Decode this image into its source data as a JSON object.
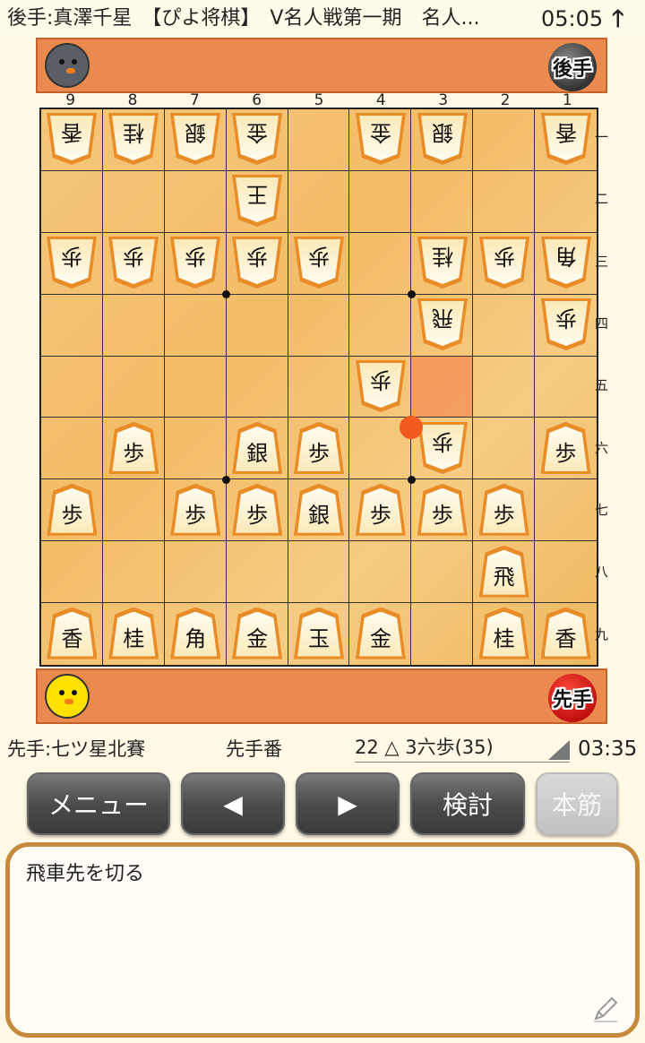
{
  "header": {
    "title": "後手:真澤千星　【ぴよ将棋】　V名人戦第一期　名人...",
    "time": "05:05",
    "up_arrow": "🡑"
  },
  "gote_hand": {
    "badge": "後手",
    "avatar_icon": "gray-chick-avatar"
  },
  "sente_hand": {
    "badge": "先手",
    "avatar_icon": "yellow-chick-avatar"
  },
  "board": {
    "file_labels": [
      "9",
      "8",
      "7",
      "6",
      "5",
      "4",
      "3",
      "2",
      "1"
    ],
    "rank_labels": [
      "一",
      "二",
      "三",
      "四",
      "五",
      "六",
      "七",
      "八",
      "九"
    ],
    "highlight_square": {
      "file": 3,
      "rank": 5
    },
    "last_move_marker": {
      "file": 3,
      "rank": 6
    },
    "pieces": [
      {
        "file": 9,
        "rank": 1,
        "char": "香",
        "owner": "gote"
      },
      {
        "file": 8,
        "rank": 1,
        "char": "桂",
        "owner": "gote"
      },
      {
        "file": 7,
        "rank": 1,
        "char": "銀",
        "owner": "gote"
      },
      {
        "file": 6,
        "rank": 1,
        "char": "金",
        "owner": "gote"
      },
      {
        "file": 4,
        "rank": 1,
        "char": "金",
        "owner": "gote"
      },
      {
        "file": 3,
        "rank": 1,
        "char": "銀",
        "owner": "gote"
      },
      {
        "file": 1,
        "rank": 1,
        "char": "香",
        "owner": "gote"
      },
      {
        "file": 6,
        "rank": 2,
        "char": "王",
        "owner": "gote"
      },
      {
        "file": 9,
        "rank": 3,
        "char": "歩",
        "owner": "gote"
      },
      {
        "file": 8,
        "rank": 3,
        "char": "歩",
        "owner": "gote"
      },
      {
        "file": 7,
        "rank": 3,
        "char": "歩",
        "owner": "gote"
      },
      {
        "file": 6,
        "rank": 3,
        "char": "歩",
        "owner": "gote"
      },
      {
        "file": 5,
        "rank": 3,
        "char": "歩",
        "owner": "gote"
      },
      {
        "file": 3,
        "rank": 3,
        "char": "桂",
        "owner": "gote"
      },
      {
        "file": 2,
        "rank": 3,
        "char": "歩",
        "owner": "gote"
      },
      {
        "file": 1,
        "rank": 3,
        "char": "角",
        "owner": "gote"
      },
      {
        "file": 3,
        "rank": 4,
        "char": "飛",
        "owner": "gote"
      },
      {
        "file": 1,
        "rank": 4,
        "char": "歩",
        "owner": "gote"
      },
      {
        "file": 4,
        "rank": 5,
        "char": "歩",
        "owner": "gote"
      },
      {
        "file": 3,
        "rank": 6,
        "char": "歩",
        "owner": "gote"
      },
      {
        "file": 8,
        "rank": 6,
        "char": "歩",
        "owner": "sente"
      },
      {
        "file": 6,
        "rank": 6,
        "char": "銀",
        "owner": "sente"
      },
      {
        "file": 5,
        "rank": 6,
        "char": "歩",
        "owner": "sente"
      },
      {
        "file": 1,
        "rank": 6,
        "char": "歩",
        "owner": "sente"
      },
      {
        "file": 9,
        "rank": 7,
        "char": "歩",
        "owner": "sente"
      },
      {
        "file": 7,
        "rank": 7,
        "char": "歩",
        "owner": "sente"
      },
      {
        "file": 6,
        "rank": 7,
        "char": "歩",
        "owner": "sente"
      },
      {
        "file": 5,
        "rank": 7,
        "char": "銀",
        "owner": "sente"
      },
      {
        "file": 4,
        "rank": 7,
        "char": "歩",
        "owner": "sente"
      },
      {
        "file": 3,
        "rank": 7,
        "char": "歩",
        "owner": "sente"
      },
      {
        "file": 2,
        "rank": 7,
        "char": "歩",
        "owner": "sente"
      },
      {
        "file": 2,
        "rank": 8,
        "char": "飛",
        "owner": "sente"
      },
      {
        "file": 9,
        "rank": 9,
        "char": "香",
        "owner": "sente"
      },
      {
        "file": 8,
        "rank": 9,
        "char": "桂",
        "owner": "sente"
      },
      {
        "file": 7,
        "rank": 9,
        "char": "角",
        "owner": "sente"
      },
      {
        "file": 6,
        "rank": 9,
        "char": "金",
        "owner": "sente"
      },
      {
        "file": 5,
        "rank": 9,
        "char": "玉",
        "owner": "sente"
      },
      {
        "file": 4,
        "rank": 9,
        "char": "金",
        "owner": "sente"
      },
      {
        "file": 2,
        "rank": 9,
        "char": "桂",
        "owner": "sente"
      },
      {
        "file": 1,
        "rank": 9,
        "char": "香",
        "owner": "sente"
      }
    ]
  },
  "status": {
    "sente_name": "先手:七ツ星北賽",
    "turn": "先手番",
    "move": "22 △ 3六歩(35)",
    "clock": "03:35"
  },
  "buttons": {
    "menu": "メニュー",
    "prev": "◀",
    "next": "▶",
    "analyze": "検討",
    "mainline": "本筋"
  },
  "comment": {
    "text": "飛車先を切る",
    "edit_icon": "pencil-icon"
  }
}
